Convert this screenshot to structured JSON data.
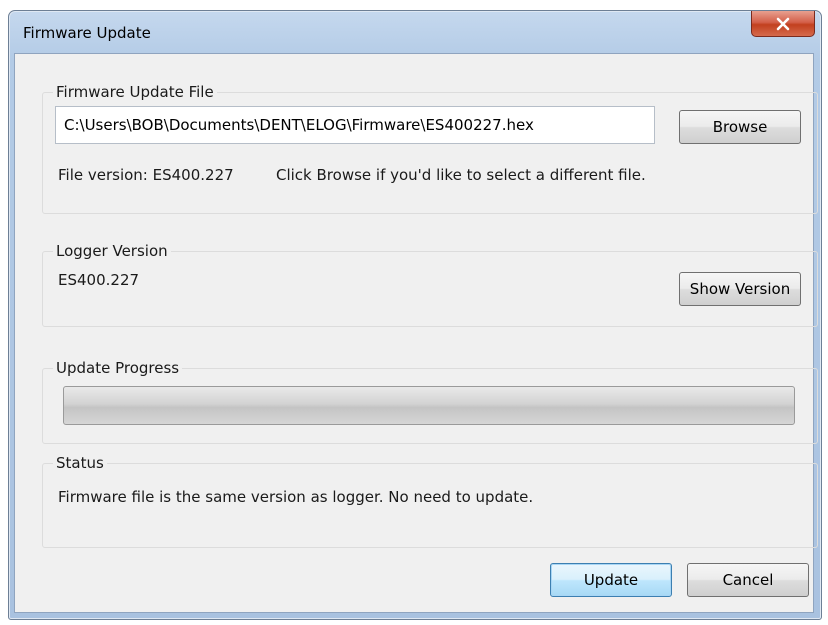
{
  "window": {
    "title": "Firmware Update",
    "close_glyph": "×"
  },
  "file_group": {
    "legend": "Firmware Update File",
    "path_value": "C:\\Users\\BOB\\Documents\\DENT\\ELOG\\Firmware\\ES400227.hex",
    "browse_label": "Browse",
    "file_version_label": "File version: ES400.227",
    "hint": "Click Browse if you'd like to select a different file."
  },
  "logger_group": {
    "legend": "Logger Version",
    "version_value": "ES400.227",
    "show_version_label": "Show Version"
  },
  "progress_group": {
    "legend": "Update Progress",
    "progress_fraction": 0
  },
  "status_group": {
    "legend": "Status",
    "message": "Firmware file is the same version as logger. No need to update."
  },
  "footer": {
    "update_label": "Update",
    "cancel_label": "Cancel"
  },
  "icons": {
    "close": "close-icon"
  }
}
